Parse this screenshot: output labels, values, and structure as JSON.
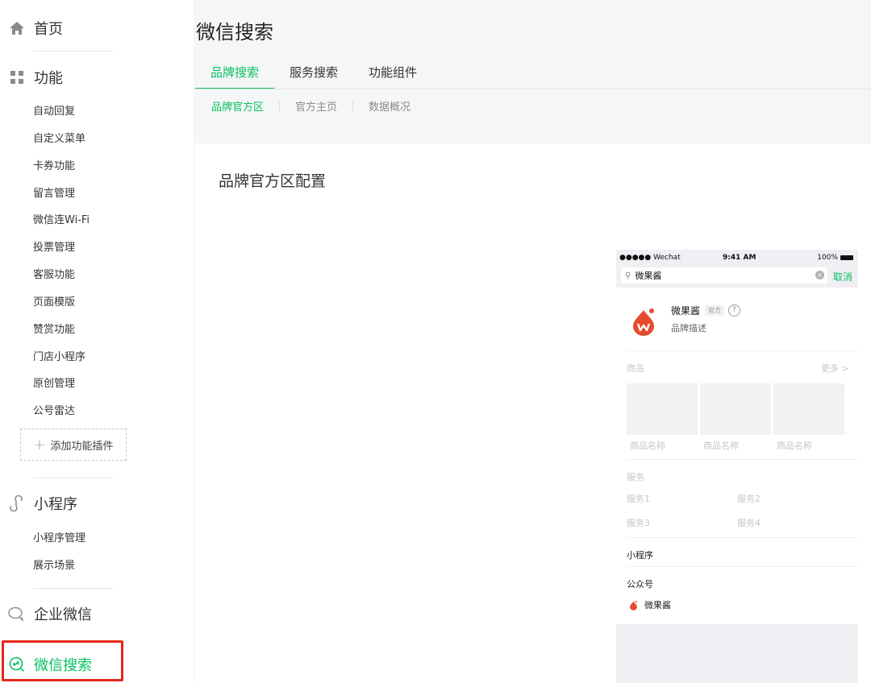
{
  "sidebar": {
    "home": "首页",
    "functions": {
      "title": "功能",
      "items": [
        "自动回复",
        "自定义菜单",
        "卡券功能",
        "留言管理",
        "微信连Wi-Fi",
        "投票管理",
        "客服功能",
        "页面模版",
        "赞赏功能",
        "门店小程序",
        "原创管理",
        "公号雷达"
      ],
      "add_plugin": "添加功能插件"
    },
    "miniprogram": {
      "title": "小程序",
      "items": [
        "小程序管理",
        "展示场景"
      ]
    },
    "enterprise": "企业微信",
    "wechat_search": "微信搜索"
  },
  "main": {
    "title": "微信搜索",
    "tabs": [
      "品牌搜索",
      "服务搜索",
      "功能组件"
    ],
    "subtabs": [
      "品牌官方区",
      "官方主页",
      "数据概况"
    ],
    "section_title": "品牌官方区配置"
  },
  "phone": {
    "status": {
      "carrier": "●●●●● Wechat",
      "time": "9:41 AM",
      "battery": "100%"
    },
    "search_value": "微果酱",
    "cancel": "取消",
    "brand": {
      "name": "微果酱",
      "badge": "官方",
      "question": "?",
      "desc": "品牌描述"
    },
    "goods": {
      "title": "商品",
      "more": "更多 >",
      "names": [
        "商品名称",
        "商品名称",
        "商品名称"
      ]
    },
    "services": {
      "title": "服务",
      "items": [
        "服务1",
        "服务2",
        "服务3",
        "服务4"
      ]
    },
    "miniprogram_label": "小程序",
    "official_label": "公众号",
    "official_name": "微果酱"
  },
  "colors": {
    "accent": "#07c160",
    "highlight_box": "#e5281c",
    "brand_red": "#e64b2e"
  }
}
